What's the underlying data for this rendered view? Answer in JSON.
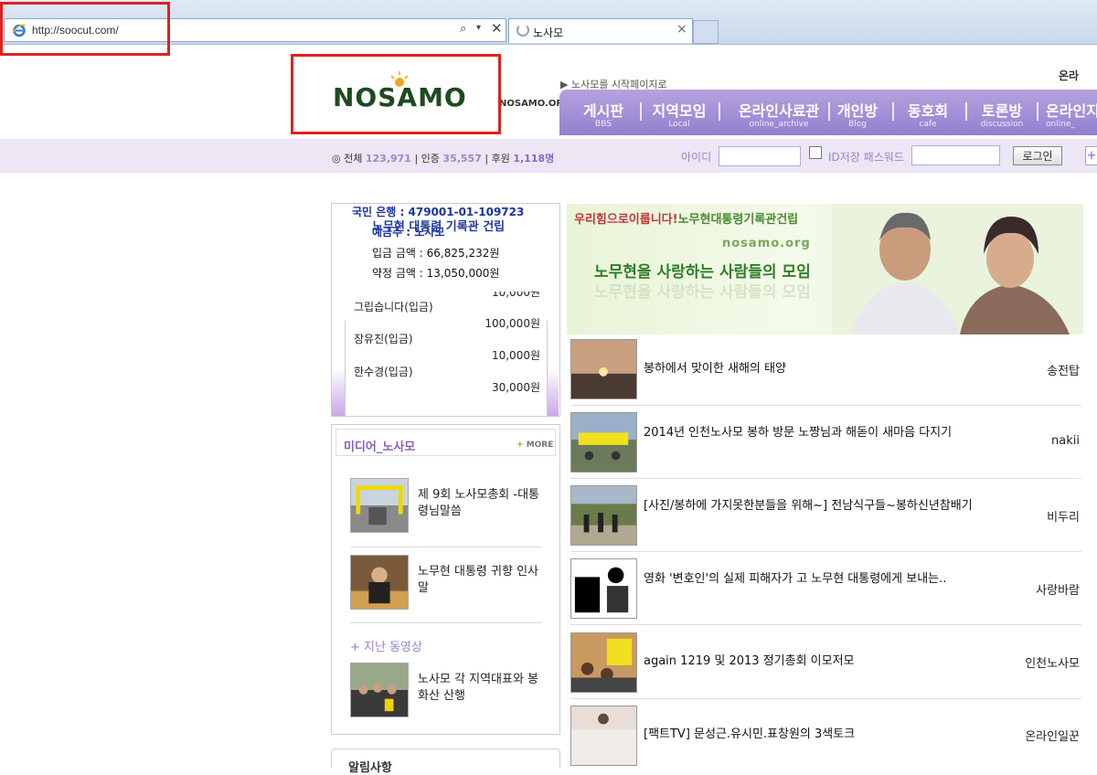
{
  "browser": {
    "url": "http://soocut.com/",
    "tab_title": "노사모",
    "search_icon": "🔍",
    "dropdown_icon": "▾",
    "close_icon": "✕",
    "tab_close_icon": "×"
  },
  "header": {
    "logo_text": "NOSAMO",
    "logo_domain": "NOSAMO.ORG",
    "start_page_link": "▶ 노사모를 시작페이지로",
    "online_link": "온라",
    "nav": [
      {
        "label": "게시판",
        "sub": "BBS"
      },
      {
        "label": "지역모임",
        "sub": "Local"
      },
      {
        "label": "온라인사료관",
        "sub": "online_archive"
      },
      {
        "label": "개인방",
        "sub": "Blog"
      },
      {
        "label": "동호회",
        "sub": "cafe"
      },
      {
        "label": "토론방",
        "sub": "discussion"
      },
      {
        "label": "온라인지",
        "sub": "online_"
      }
    ]
  },
  "login": {
    "stats_total_label": "전체",
    "stats_total": "123,971",
    "stats_verified_label": "인증",
    "stats_verified": "35,557",
    "stats_sponsor_label": "후원",
    "stats_sponsor": "1,118명",
    "id_label": "아이디",
    "save_id_label": "ID저장 패스워드",
    "login_button": "로그인",
    "plus_button": "+"
  },
  "donation": {
    "bank_line": "국민 은행 : 479001-01-109723",
    "project": "노무현 대통령 기록관 건립",
    "holder": "예금주 : 노사모",
    "deposit_label": "입금 금액",
    "deposit_value": "66,825,232원",
    "pledge_label": "약정 금액",
    "pledge_value": "13,050,000원",
    "donors": [
      {
        "name": "",
        "amount": "10,000원"
      },
      {
        "name": "그립습니다(입금)",
        "amount": ""
      },
      {
        "name": "",
        "amount": "100,000원"
      },
      {
        "name": "장유진(입금)",
        "amount": ""
      },
      {
        "name": "",
        "amount": "10,000원"
      },
      {
        "name": "한수경(입금)",
        "amount": ""
      },
      {
        "name": "",
        "amount": "30,000원"
      }
    ]
  },
  "media": {
    "title": "미디어_노사모",
    "more_plus": "+",
    "more_label": "MORE",
    "items": [
      {
        "title": "제 9회 노사모총회 -대통령님말씀"
      },
      {
        "title": "노무현 대통령 귀향 인사말"
      }
    ],
    "past_label": "+ 지난 동영상",
    "past_item": {
      "title": "노사모 각 지역대표와 봉화산 산행"
    },
    "notice_title": "알림사항"
  },
  "banner": {
    "slogan_red": "우리힘으로이룹니다!",
    "slogan_green": "노무현대통령기록관건립",
    "url": "nosamo.org",
    "main": "노무현을 사랑하는 사람들의 모임"
  },
  "news": [
    {
      "title": "봉하에서 맞이한 새해의 태양",
      "author": "송전탑"
    },
    {
      "title": "2014년 인천노사모 봉하 방문 노짱님과 해돋이 새마음 다지기",
      "author": "nakii"
    },
    {
      "title": "[사진/봉하에 가지못한분들을 위해~] 전남식구들~봉하신년참배기",
      "author": "비두리"
    },
    {
      "title": "영화 '변호인'의 실제 피해자가 고 노무현 대통령에게 보내는..",
      "author": "사랑바람"
    },
    {
      "title": "again 1219 및 2013 정기총회 이모저모",
      "author": "인천노사모"
    },
    {
      "title": "[팩트TV] 문성근.유시민.표창원의 3색토크",
      "author": "온라인일꾼"
    }
  ]
}
